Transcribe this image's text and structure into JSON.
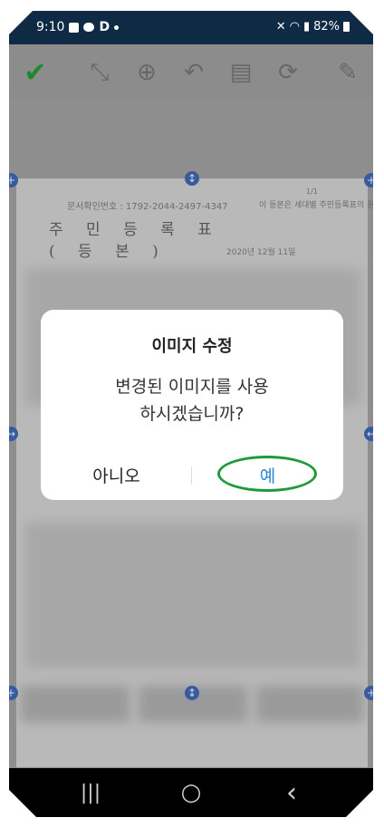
{
  "status_bar": {
    "time": "9:10",
    "battery": "82%",
    "right_icons": [
      "mute-icon",
      "wifi-icon",
      "volte-icon",
      "signal-icon",
      "battery-icon"
    ],
    "left_icons": [
      "gallery-icon",
      "chat-icon",
      "d-app-icon",
      "dot-icon"
    ]
  },
  "toolbar": {
    "icons": [
      "check-icon",
      "expand-icon",
      "zoom-icon",
      "undo-icon",
      "document-icon",
      "rotate-icon",
      "edit-icon"
    ],
    "accent": "#1e8a2e"
  },
  "document": {
    "header_number": "문서확인번호 : 1792-2044-2497-4347",
    "title_line1": "주 민 등 록 표",
    "title_line2": "( 등      본 )",
    "page_marker": "1/1",
    "right_block": "이 등본은 세대별 주민등록표의 원본 내용과",
    "date": "2020년 12월 11일"
  },
  "dialog": {
    "title": "이미지 수정",
    "message_line1": "변경된 이미지를 사용",
    "message_line2": "하시겠습니까?",
    "no_label": "아니오",
    "yes_label": "예",
    "highlight_color": "#1e9a3a",
    "yes_color": "#2a8ad8"
  },
  "nav_bar": {
    "recent": "|||",
    "home": "○",
    "back": "‹"
  }
}
